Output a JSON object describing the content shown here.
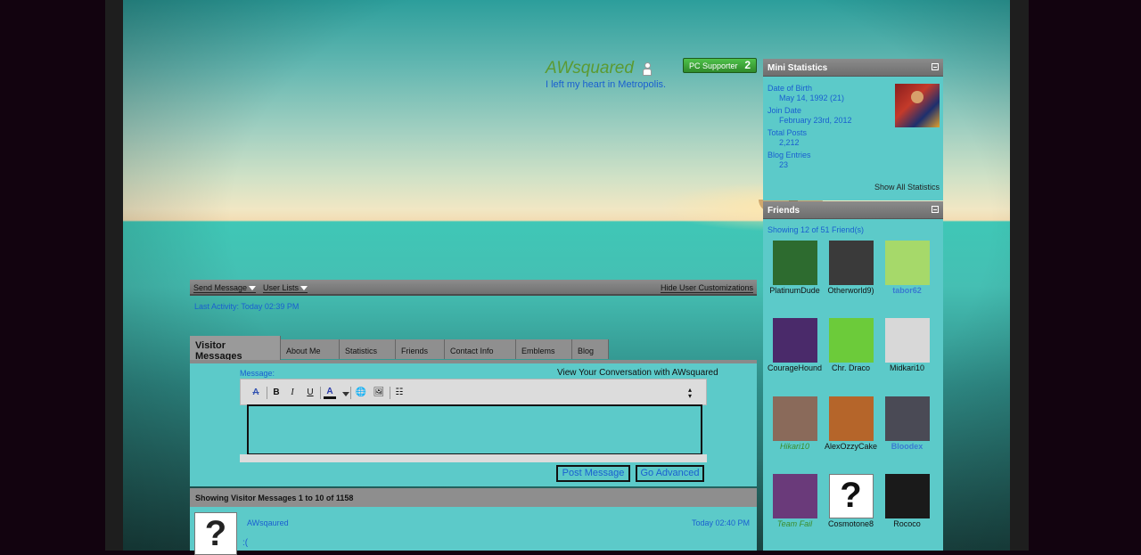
{
  "profile": {
    "username": "AWsquared",
    "user_title": "I left my heart in Metropolis.",
    "badge": {
      "label": "PC Supporter",
      "count": "2"
    }
  },
  "sidebar": {
    "mini_stats": {
      "title": "Mini Statistics",
      "items": [
        {
          "label": "Date of Birth",
          "value": "May 14, 1992 (21)"
        },
        {
          "label": "Join Date",
          "value": "February 23rd, 2012"
        },
        {
          "label": "Total Posts",
          "value": "2,212"
        },
        {
          "label": "Blog Entries",
          "value": "23"
        }
      ],
      "show_all": "Show All Statistics"
    },
    "friends": {
      "title": "Friends",
      "count_text": "Showing 12 of 51 Friend(s)",
      "list": [
        {
          "name": "PlatinumDude",
          "style": "normal",
          "color": "#2d6b2f"
        },
        {
          "name": "Otherworld9)",
          "style": "normal",
          "color": "#3a3a3a"
        },
        {
          "name": "tabor62",
          "style": "blue",
          "color": "#a6d96a"
        },
        {
          "name": "CourageHound",
          "style": "normal",
          "color": "#4a2a6a"
        },
        {
          "name": "Chr. Draco",
          "style": "normal",
          "color": "#6ccb3a"
        },
        {
          "name": "Midkari10",
          "style": "normal",
          "color": "#d8d8d8"
        },
        {
          "name": "Hikari10",
          "style": "green",
          "color": "#8a6a5a"
        },
        {
          "name": "AlexOzzyCake",
          "style": "normal",
          "color": "#b5652a"
        },
        {
          "name": "Bloodex",
          "style": "blue",
          "color": "#4a4a55"
        },
        {
          "name": "Team Fail",
          "style": "green",
          "color": "#6a3a7a"
        },
        {
          "name": "Cosmotone8",
          "style": "normal",
          "color": "#ffffff"
        },
        {
          "name": "Rococo",
          "style": "normal",
          "color": "#1a1a1a"
        }
      ]
    }
  },
  "actions": {
    "send_message": "Send Message",
    "user_lists": "User Lists",
    "hide_custom": "Hide User Customizations"
  },
  "last_activity": "Last Activity: Today 02:39 PM",
  "tabs": [
    "Visitor Messages",
    "About Me",
    "Statistics",
    "Friends",
    "Contact Info",
    "Emblems",
    "Blog"
  ],
  "editor": {
    "message_label": "Message:",
    "conversation_link": "View Your Conversation with AWsquared",
    "post_button": "Post Message",
    "advanced_button": "Go Advanced"
  },
  "visitor_messages": {
    "header": "Showing Visitor Messages 1 to 10 of 1158",
    "first": {
      "author": "AWsqaured",
      "time": "Today 02:40 PM",
      "text": ":("
    }
  }
}
